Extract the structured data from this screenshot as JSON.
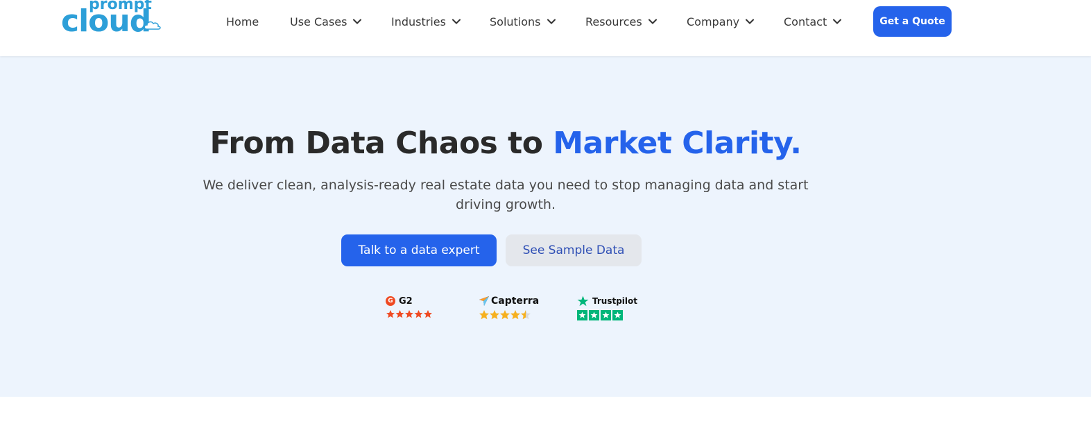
{
  "brand": {
    "logo_top": "prompt",
    "logo_bottom": "cloud",
    "color": "#2d9fd8"
  },
  "nav": {
    "items": [
      {
        "label": "Home",
        "has_dropdown": false
      },
      {
        "label": "Use Cases",
        "has_dropdown": true
      },
      {
        "label": "Industries",
        "has_dropdown": true
      },
      {
        "label": "Solutions",
        "has_dropdown": true
      },
      {
        "label": "Resources",
        "has_dropdown": true
      },
      {
        "label": "Company",
        "has_dropdown": true
      },
      {
        "label": "Contact",
        "has_dropdown": true
      }
    ],
    "cta_label": "Get a Quote"
  },
  "hero": {
    "headline_main": "From Data Chaos to ",
    "headline_accent": "Market Clarity.",
    "subtext": "We deliver clean, analysis-ready real estate data you need to stop managing data and start driving growth.",
    "primary_button": "Talk to a data expert",
    "secondary_button": "See Sample Data",
    "background": "#edf4fd",
    "accent_color": "#2563eb"
  },
  "reviews": [
    {
      "name": "G2",
      "icon": "g2-logo-icon",
      "rating": 5,
      "star_color": "#ef4a23"
    },
    {
      "name": "Capterra",
      "icon": "capterra-logo-icon",
      "rating": 4.5,
      "star_color": "#f6b01e"
    },
    {
      "name": "Trustpilot",
      "icon": "trustpilot-star-icon",
      "rating": 4,
      "star_color": "#00b67a"
    }
  ]
}
